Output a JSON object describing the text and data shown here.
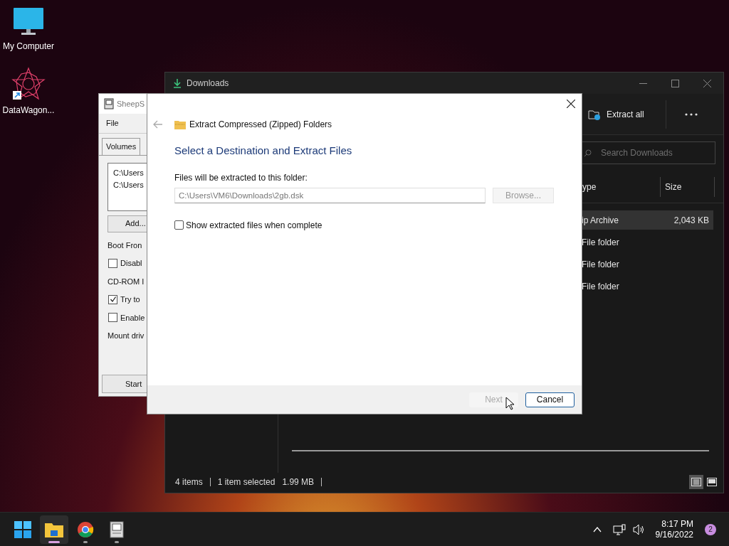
{
  "desktop_icons": [
    {
      "label": "My Computer",
      "kind": "monitor"
    },
    {
      "label": "DataWagon...",
      "kind": "star"
    }
  ],
  "sheepshaver": {
    "title": "SheepS",
    "menu": [
      "File"
    ],
    "tabs": [
      {
        "label": "Volumes",
        "selected": true
      }
    ],
    "volumes": [
      "C:\\Users",
      "C:\\Users"
    ],
    "add_button": "Add...",
    "options": [
      {
        "kind": "label",
        "text": "Boot Fron"
      },
      {
        "kind": "checkbox",
        "text": "Disabl",
        "checked": false
      },
      {
        "kind": "label",
        "text": "CD-ROM I"
      },
      {
        "kind": "checkbox",
        "text": "Try to",
        "checked": true
      },
      {
        "kind": "checkbox",
        "text": "Enable",
        "checked": false
      },
      {
        "kind": "label",
        "text": "Mount driv"
      }
    ],
    "start_button": "Start"
  },
  "explorer": {
    "title": "Downloads",
    "extract_all": "Extract all",
    "search": {
      "placeholder": "Search Downloads"
    },
    "columns": [
      "ype",
      "Size"
    ],
    "rows": [
      {
        "type": "ip Archive",
        "size": "2,043 KB",
        "selected": true
      },
      {
        "type": "File folder",
        "size": "",
        "selected": false
      },
      {
        "type": "File folder",
        "size": "",
        "selected": false
      },
      {
        "type": "File folder",
        "size": "",
        "selected": false
      }
    ],
    "status": {
      "items": "4 items",
      "selected": "1 item selected",
      "size": "1.99 MB"
    },
    "views": [
      {
        "kind": "details",
        "selected": true
      },
      {
        "kind": "tiles",
        "selected": false
      }
    ]
  },
  "dialog": {
    "title": "Extract Compressed (Zipped) Folders",
    "heading": "Select a Destination and Extract Files",
    "field_label": "Files will be extracted to this folder:",
    "path": "C:\\Users\\VM6\\Downloads\\2gb.dsk",
    "browse": {
      "label": "Browse...",
      "disabled": true
    },
    "show_files": {
      "label": "Show extracted files when complete",
      "checked": false
    },
    "buttons": [
      {
        "label": "Next",
        "disabled": true
      },
      {
        "label": "Cancel",
        "disabled": false
      }
    ]
  },
  "taskbar": {
    "apps": [
      {
        "kind": "start",
        "running": false,
        "selected": false
      },
      {
        "kind": "folder",
        "running": true,
        "selected": true
      },
      {
        "kind": "browser",
        "running": true,
        "selected": false
      },
      {
        "kind": "mac",
        "running": true,
        "selected": false
      }
    ],
    "time": "8:17 PM",
    "date": "9/16/2022",
    "notifications": "2"
  }
}
